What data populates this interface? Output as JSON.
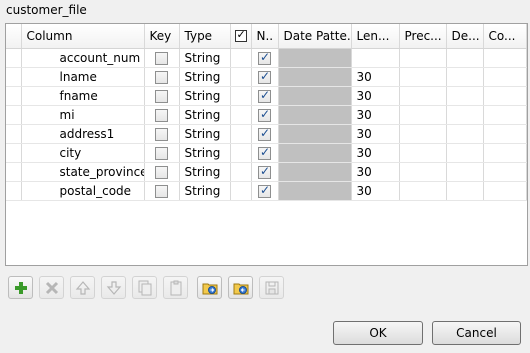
{
  "title": "customer_file",
  "columns": {
    "column": "Column",
    "key": "Key",
    "type": "Type",
    "nullable": "N..",
    "date_pattern": "Date Patte...",
    "length": "Len...",
    "precision": "Prec...",
    "default": "De...",
    "comment": "Co..."
  },
  "rows": [
    {
      "name": "account_num",
      "key": false,
      "type": "String",
      "nullable": true,
      "length": ""
    },
    {
      "name": "lname",
      "key": false,
      "type": "String",
      "nullable": true,
      "length": "30"
    },
    {
      "name": "fname",
      "key": false,
      "type": "String",
      "nullable": true,
      "length": "30"
    },
    {
      "name": "mi",
      "key": false,
      "type": "String",
      "nullable": true,
      "length": "30"
    },
    {
      "name": "address1",
      "key": false,
      "type": "String",
      "nullable": true,
      "length": "30"
    },
    {
      "name": "city",
      "key": false,
      "type": "String",
      "nullable": true,
      "length": "30"
    },
    {
      "name": "state_province",
      "key": false,
      "type": "String",
      "nullable": true,
      "length": "30"
    },
    {
      "name": "postal_code",
      "key": false,
      "type": "String",
      "nullable": true,
      "length": "30"
    }
  ],
  "toolbar": [
    {
      "name": "add-icon",
      "enabled": true
    },
    {
      "name": "remove-icon",
      "enabled": false
    },
    {
      "name": "move-up-icon",
      "enabled": false
    },
    {
      "name": "move-down-icon",
      "enabled": false
    },
    {
      "name": "copy-icon",
      "enabled": false
    },
    {
      "name": "paste-icon",
      "enabled": false
    },
    {
      "name": "import-schema-icon",
      "enabled": true
    },
    {
      "name": "export-schema-icon",
      "enabled": true
    },
    {
      "name": "save-icon",
      "enabled": false
    }
  ],
  "buttons": {
    "ok": "OK",
    "cancel": "Cancel"
  },
  "colors": {
    "disabled_cell": "#c0c0c0",
    "add_green": "#3a9a2a"
  }
}
